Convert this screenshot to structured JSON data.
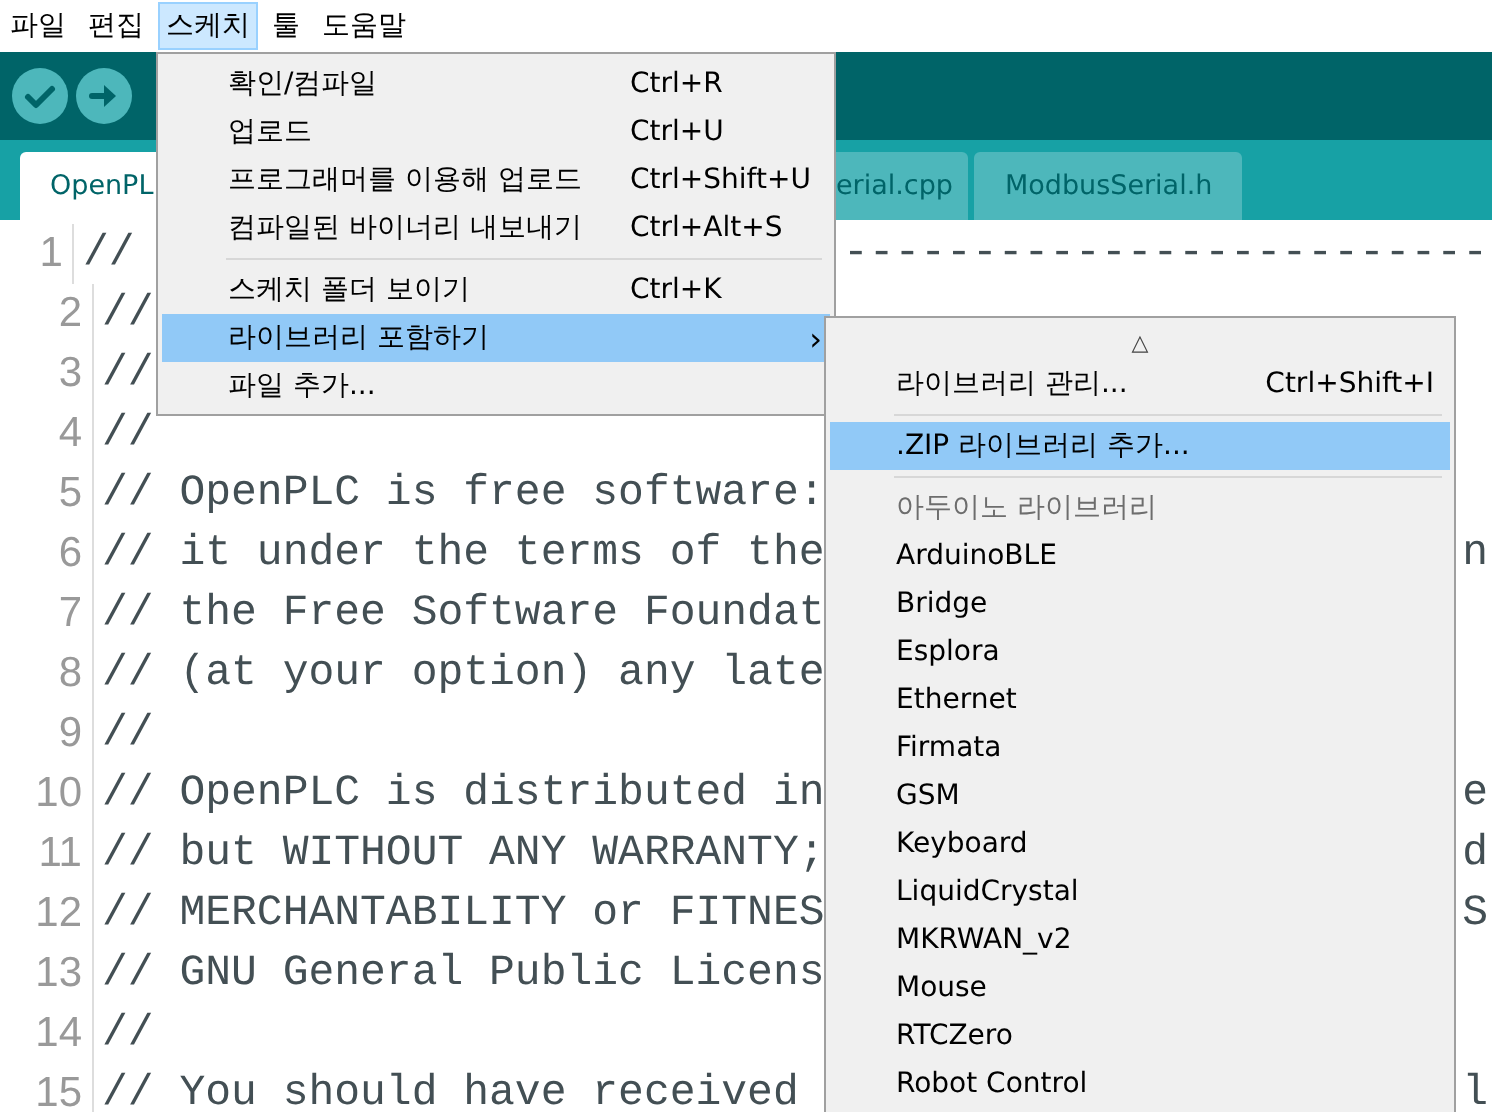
{
  "menubar": [
    {
      "label": "파일",
      "selected": false
    },
    {
      "label": "편집",
      "selected": false
    },
    {
      "label": "스케치",
      "selected": true
    },
    {
      "label": "툴",
      "selected": false
    },
    {
      "label": "도움말",
      "selected": false
    }
  ],
  "toolbar": [
    {
      "kind": "verify"
    },
    {
      "kind": "upload"
    }
  ],
  "tabs": [
    {
      "label": "OpenPL",
      "selected": true
    },
    {
      "label": "erial.cpp",
      "selected": false
    },
    {
      "label": "ModbusSerial.h",
      "selected": false
    }
  ],
  "code_lines": [
    {
      "number": "1",
      "text": "//",
      "tail": "-------------------------"
    },
    {
      "number": "2",
      "text": "//"
    },
    {
      "number": "3",
      "text": "//"
    },
    {
      "number": "4",
      "text": "//"
    },
    {
      "number": "5",
      "text": "// OpenPLC is free software:"
    },
    {
      "number": "6",
      "text": "// it under the terms of the",
      "tail": "n"
    },
    {
      "number": "7",
      "text": "// the Free Software Foundat"
    },
    {
      "number": "8",
      "text": "// (at your option) any late"
    },
    {
      "number": "9",
      "text": "//"
    },
    {
      "number": "10",
      "text": "// OpenPLC is distributed in",
      "tail": "e"
    },
    {
      "number": "11",
      "text": "// but WITHOUT ANY WARRANTY;",
      "tail": "d"
    },
    {
      "number": "12",
      "text": "// MERCHANTABILITY or FITNES",
      "tail": "S"
    },
    {
      "number": "13",
      "text": "// GNU General Public Licens"
    },
    {
      "number": "14",
      "text": "//"
    },
    {
      "number": "15",
      "text": "// You should have received",
      "tail": "l"
    }
  ],
  "sketch_menu": [
    {
      "kind": "item",
      "label": "확인/컴파일",
      "shortcut": "Ctrl+R",
      "selected": false
    },
    {
      "kind": "item",
      "label": "업로드",
      "shortcut": "Ctrl+U",
      "selected": false
    },
    {
      "kind": "item",
      "label": "프로그래머를 이용해 업로드",
      "shortcut": "Ctrl+Shift+U",
      "selected": false
    },
    {
      "kind": "item",
      "label": "컴파일된 바이너리 내보내기",
      "shortcut": "Ctrl+Alt+S",
      "selected": false
    },
    {
      "kind": "separator"
    },
    {
      "kind": "item",
      "label": "스케치 폴더 보이기",
      "shortcut": "Ctrl+K",
      "selected": false
    },
    {
      "kind": "submenu",
      "label": "라이브러리 포함하기",
      "arrow": "›",
      "selected": true
    },
    {
      "kind": "item",
      "label": "파일 추가...",
      "selected": false
    }
  ],
  "library_submenu": [
    {
      "kind": "scroll",
      "label": "△"
    },
    {
      "kind": "item",
      "label": "라이브러리 관리...",
      "shortcut": "Ctrl+Shift+I",
      "selected": false
    },
    {
      "kind": "separator"
    },
    {
      "kind": "item",
      "label": ".ZIP 라이브러리 추가...",
      "selected": true
    },
    {
      "kind": "separator"
    },
    {
      "kind": "header",
      "label": "아두이노 라이브러리"
    },
    {
      "kind": "item",
      "label": "ArduinoBLE",
      "selected": false
    },
    {
      "kind": "item",
      "label": "Bridge",
      "selected": false
    },
    {
      "kind": "item",
      "label": "Esplora",
      "selected": false
    },
    {
      "kind": "item",
      "label": "Ethernet",
      "selected": false
    },
    {
      "kind": "item",
      "label": "Firmata",
      "selected": false
    },
    {
      "kind": "item",
      "label": "GSM",
      "selected": false
    },
    {
      "kind": "item",
      "label": "Keyboard",
      "selected": false
    },
    {
      "kind": "item",
      "label": "LiquidCrystal",
      "selected": false
    },
    {
      "kind": "item",
      "label": "MKRWAN_v2",
      "selected": false
    },
    {
      "kind": "item",
      "label": "Mouse",
      "selected": false
    },
    {
      "kind": "item",
      "label": "RTCZero",
      "selected": false
    },
    {
      "kind": "item",
      "label": "Robot Control",
      "selected": false
    }
  ]
}
